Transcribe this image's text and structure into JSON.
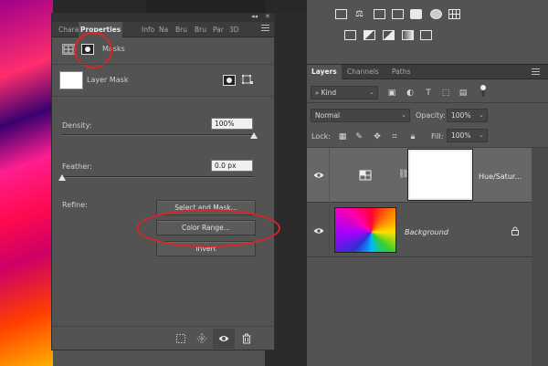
{
  "properties_panel": {
    "collapse_glyph": "◂◂",
    "close_glyph": "✕",
    "tabs": [
      "Character",
      "Properties",
      "Info",
      "Navigator",
      "Brushes",
      "Paragraph",
      "3D"
    ],
    "tabs_display": [
      "Chara",
      "Properties",
      "Info",
      "Na",
      "Bru",
      "Bru",
      "Par",
      "3D"
    ],
    "section_title": "Masks",
    "mask_label": "Layer Mask",
    "density_label": "Density:",
    "density_value": "100%",
    "feather_label": "Feather:",
    "feather_value": "0.0 px",
    "refine_label": "Refine:",
    "buttons": {
      "select_and_mask": "Select and Mask...",
      "color_range": "Color Range...",
      "invert": "Invert"
    },
    "density_level": 1.0,
    "feather_level": 0.0
  },
  "layers_panel": {
    "tabs": [
      "Layers",
      "Channels",
      "Paths"
    ],
    "filter_kind": "Kind",
    "blend_mode": "Normal",
    "opacity_label": "Opacity:",
    "opacity_value": "100%",
    "lock_label": "Lock:",
    "fill_label": "Fill:",
    "fill_value": "100%",
    "layers": [
      {
        "name": "Hue/Satur...",
        "visible": true,
        "selected": true,
        "type": "adjustment"
      },
      {
        "name": "Background",
        "visible": true,
        "selected": false,
        "locked": true
      }
    ]
  },
  "colors": {
    "annotation_red": "#d9252a",
    "panel_bg": "#535353",
    "tab_bar_bg": "#3c3c3c"
  }
}
